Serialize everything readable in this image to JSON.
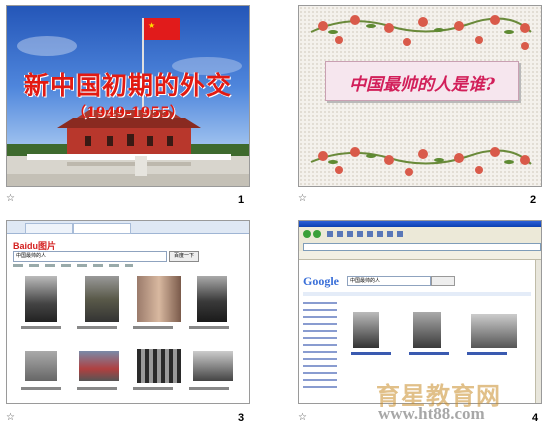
{
  "slides": [
    {
      "number": "1",
      "title": "新中国初期的外交",
      "subtitle": "（1949-1955）"
    },
    {
      "number": "2",
      "question": "中国最帅的人是谁?"
    },
    {
      "number": "3",
      "search_query": "中国最帅的人",
      "search_button": "百度一下",
      "logo": "Baidu图片"
    },
    {
      "number": "4",
      "search_query": "中国最帅的人",
      "logo": "Google"
    }
  ],
  "star_glyph": "☆",
  "watermark": {
    "cn": "育星教育网",
    "url": "www.ht88.com"
  }
}
